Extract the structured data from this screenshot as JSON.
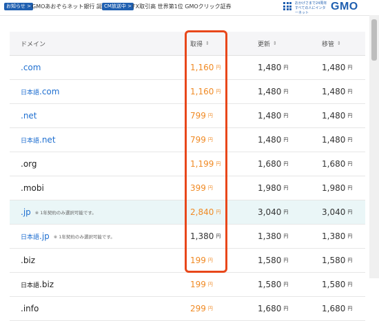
{
  "topbar": {
    "badge1": "お知らせ >",
    "text1": "GMOあおぞらネット銀行 誕生!",
    "badge2": "CM放送中 >",
    "text2": "FX取引高 世界第1位 GMOクリック証券",
    "tagline": "おかげさまで24周年 すべての人にインターネット",
    "logo": "GMO"
  },
  "table": {
    "headers": {
      "domain": "ドメイン",
      "get": "取得",
      "renew": "更新",
      "transfer": "移管",
      "sort_icon": "⇕"
    },
    "yen": "円",
    "rows": [
      {
        "domain": ".com",
        "get": "1,160",
        "renew": "1,480",
        "transfer": "1,480"
      },
      {
        "prefix": "日本語",
        "domain": ".com",
        "get": "1,160",
        "renew": "1,480",
        "transfer": "1,480"
      },
      {
        "domain": ".net",
        "get": "799",
        "renew": "1,480",
        "transfer": "1,480"
      },
      {
        "prefix": "日本語",
        "domain": ".net",
        "get": "799",
        "renew": "1,480",
        "transfer": "1,480"
      },
      {
        "domain": ".org",
        "get": "1,199",
        "renew": "1,680",
        "transfer": "1,680"
      },
      {
        "domain": ".mobi",
        "get": "399",
        "renew": "1,980",
        "transfer": "1,980"
      },
      {
        "domain": ".jp",
        "note": "※ 1年契約のみ選択可能です。",
        "get": "2,840",
        "renew": "3,040",
        "transfer": "3,040"
      },
      {
        "prefix": "日本語",
        "domain": ".jp",
        "note": "※ 1年契約のみ選択可能です。",
        "get": "1,380",
        "renew": "1,380",
        "transfer": "1,380"
      },
      {
        "domain": ".biz",
        "get": "199",
        "renew": "1,580",
        "transfer": "1,580"
      },
      {
        "prefix": "日本語",
        "domain": ".biz",
        "get": "199",
        "renew": "1,580",
        "transfer": "1,580"
      },
      {
        "domain": ".info",
        "get": "299",
        "renew": "1,680",
        "transfer": "1,680"
      }
    ]
  },
  "colors": {
    "accent_blue": "#1f6fd0",
    "price_orange": "#f08a24",
    "highlight_red": "#e8471a"
  }
}
